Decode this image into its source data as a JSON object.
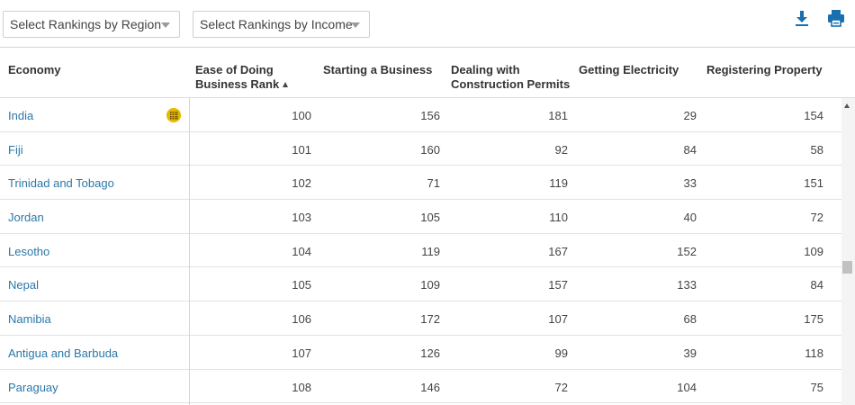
{
  "filters": {
    "region_label": "Select Rankings by Region",
    "income_label": "Select Rankings by Income"
  },
  "toolbar": {
    "download_icon": "download-icon",
    "print_icon": "printer-icon",
    "accent": "#1a6fb0"
  },
  "table": {
    "columns": [
      "Economy",
      "Ease of Doing Business Rank",
      "Starting a Business",
      "Dealing with Construction Permits",
      "Getting Electricity",
      "Registering Property"
    ],
    "column_lines": {
      "ease_line1": "Ease of Doing",
      "ease_line2": "Business Rank",
      "construction_line1": "Dealing with",
      "construction_line2": "Construction Permits"
    },
    "rows": [
      {
        "economy": "India",
        "ease": "100",
        "starting": "156",
        "construction": "181",
        "electricity": "29",
        "property": "154"
      },
      {
        "economy": "Fiji",
        "ease": "101",
        "starting": "160",
        "construction": "92",
        "electricity": "84",
        "property": "58"
      },
      {
        "economy": "Trinidad and Tobago",
        "ease": "102",
        "starting": "71",
        "construction": "119",
        "electricity": "33",
        "property": "151"
      },
      {
        "economy": "Jordan",
        "ease": "103",
        "starting": "105",
        "construction": "110",
        "electricity": "40",
        "property": "72"
      },
      {
        "economy": "Lesotho",
        "ease": "104",
        "starting": "119",
        "construction": "167",
        "electricity": "152",
        "property": "109"
      },
      {
        "economy": "Nepal",
        "ease": "105",
        "starting": "109",
        "construction": "157",
        "electricity": "133",
        "property": "84"
      },
      {
        "economy": "Namibia",
        "ease": "106",
        "starting": "172",
        "construction": "107",
        "electricity": "68",
        "property": "175"
      },
      {
        "economy": "Antigua and Barbuda",
        "ease": "107",
        "starting": "126",
        "construction": "99",
        "electricity": "39",
        "property": "118"
      },
      {
        "economy": "Paraguay",
        "ease": "108",
        "starting": "146",
        "construction": "72",
        "electricity": "104",
        "property": "75"
      }
    ],
    "link_color": "#2a78a8",
    "highlight_icon": "grid-icon",
    "highlight_color": "#e6b800"
  }
}
